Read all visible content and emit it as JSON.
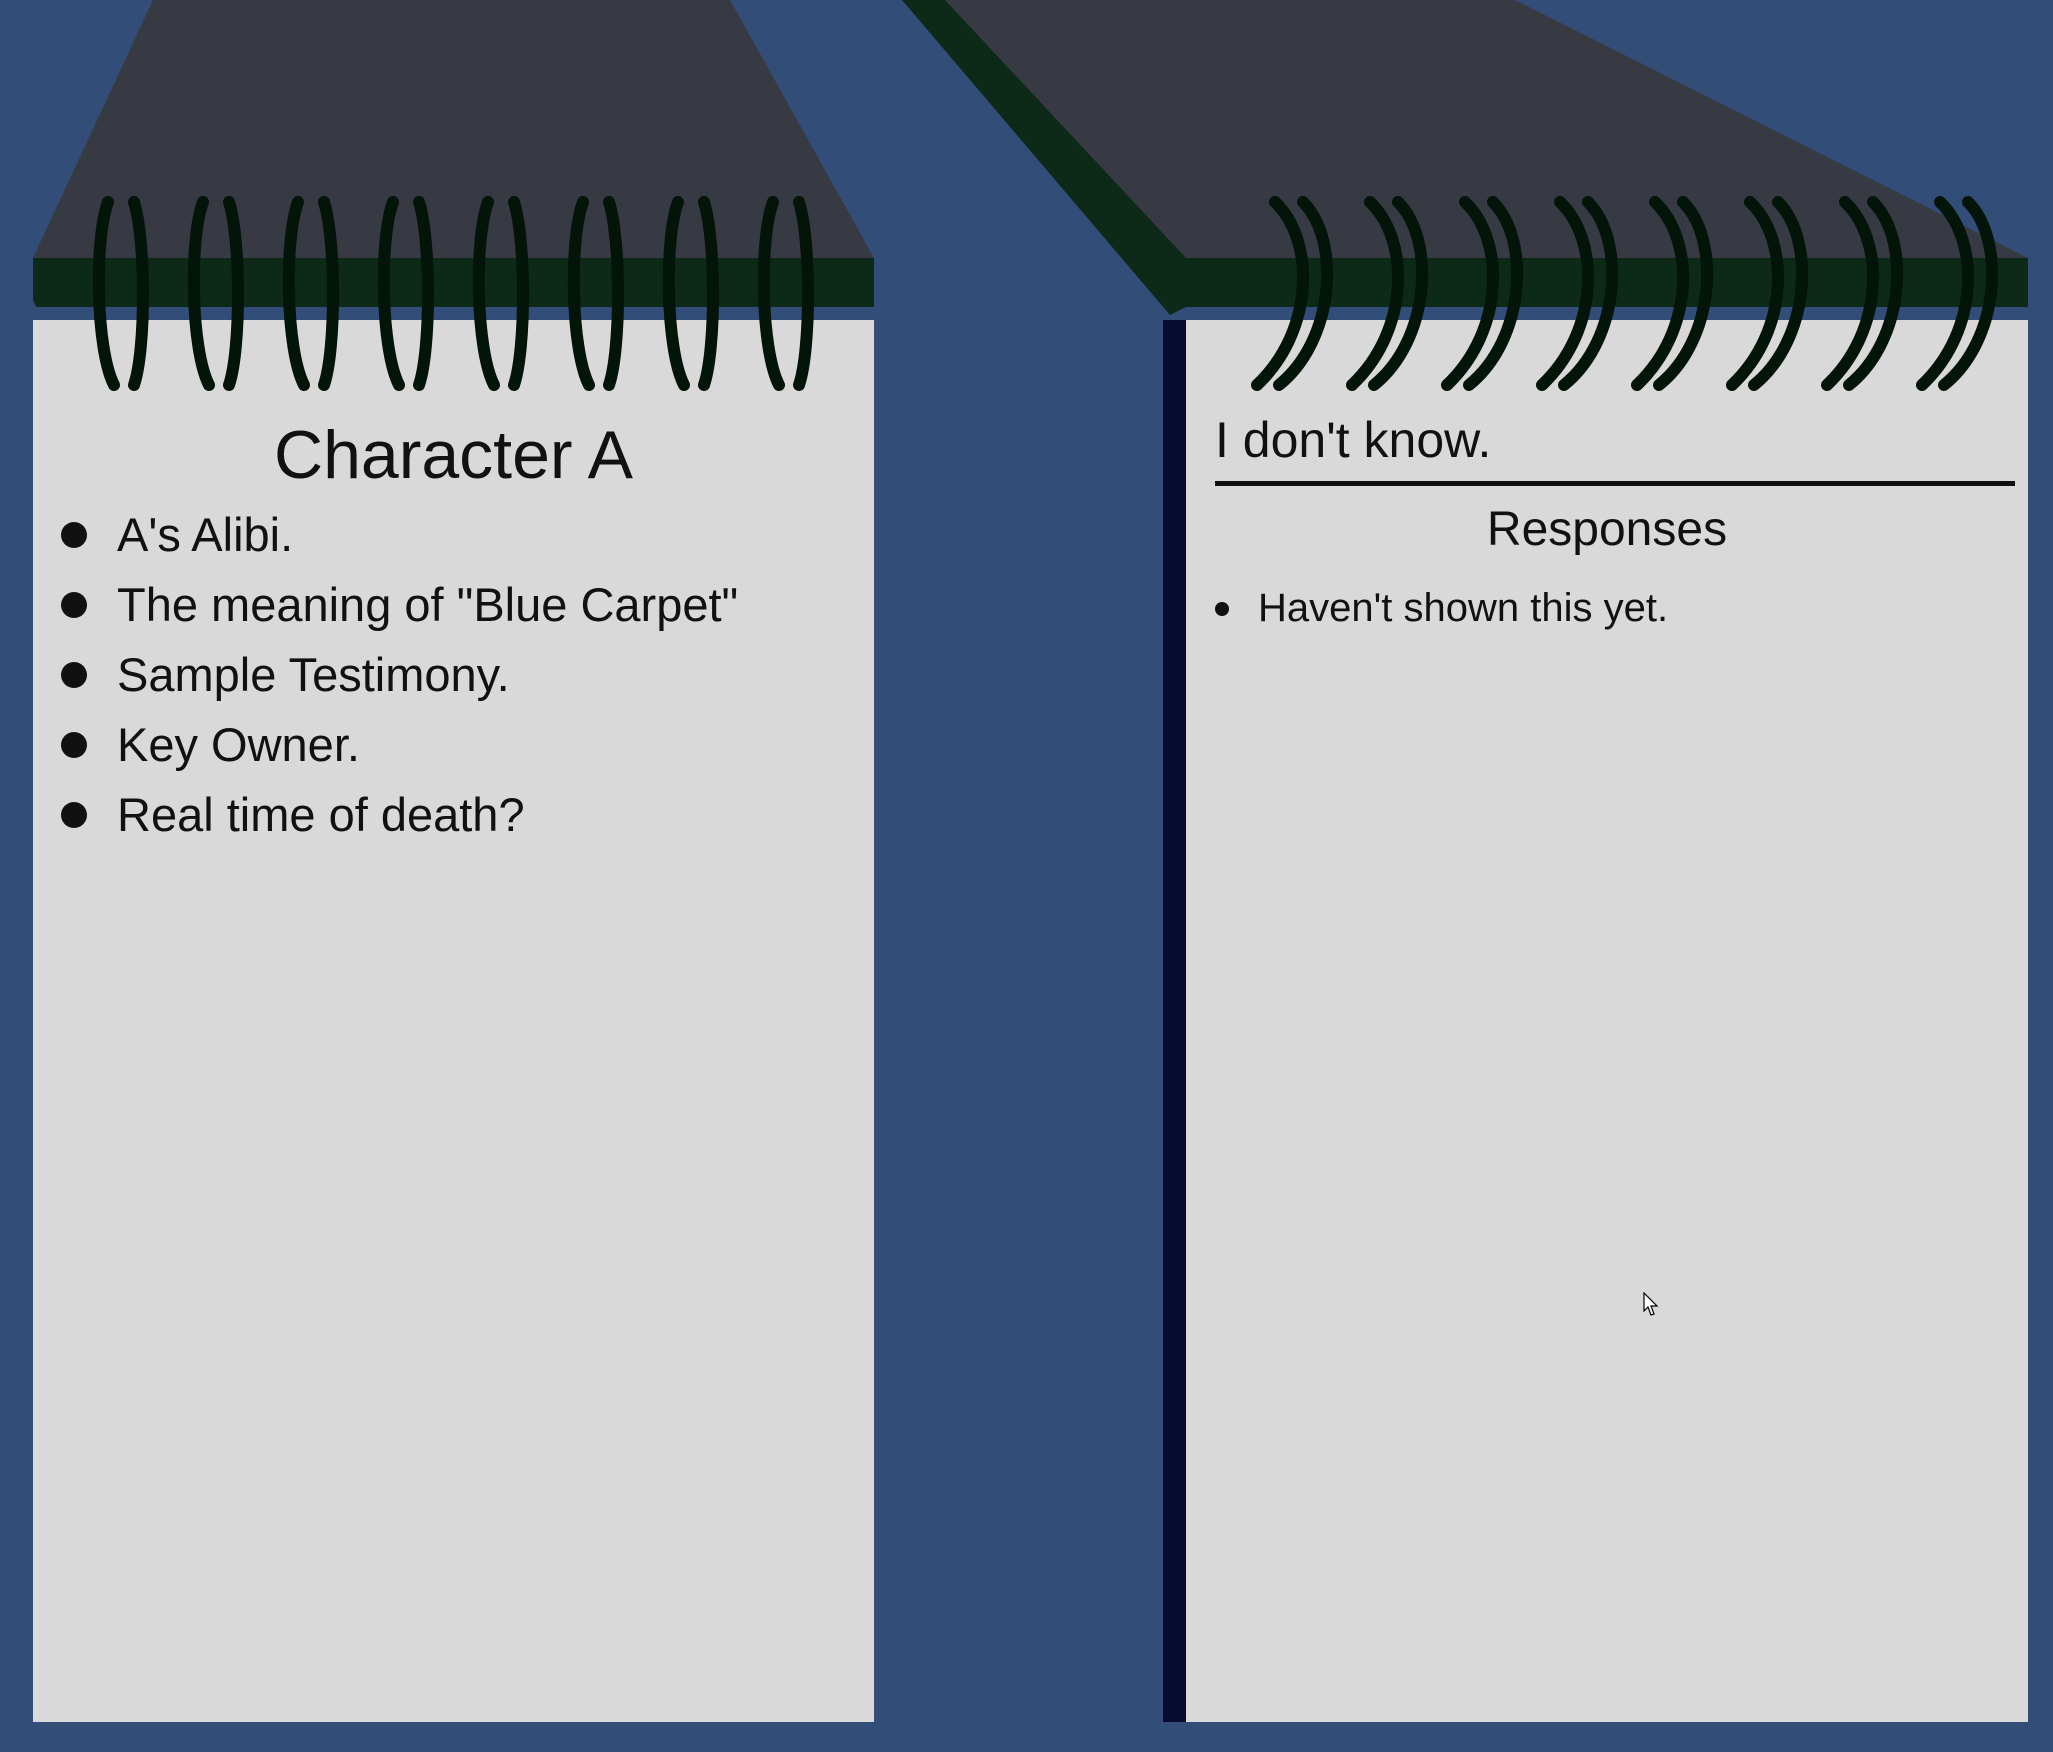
{
  "colors": {
    "background": "#314d78",
    "page": "#d9d9d9",
    "cover": "#373a42",
    "cover_edge": "#0d2a18",
    "coil": "#031409",
    "spine_shadow": "#070b2e"
  },
  "left_notebook": {
    "title": "Character A",
    "topics": [
      {
        "label": "A's Alibi."
      },
      {
        "label": "The meaning of \"Blue Carpet\""
      },
      {
        "label": "Sample Testimony."
      },
      {
        "label": "Key Owner."
      },
      {
        "label": "Real time of death?"
      }
    ]
  },
  "right_notebook": {
    "answer": "I don't know.",
    "responses_title": "Responses",
    "responses": [
      {
        "label": "Haven't shown this yet."
      }
    ]
  },
  "icons": {
    "spiral": "spiral-binding-icon",
    "cursor": "mouse-pointer-icon"
  }
}
